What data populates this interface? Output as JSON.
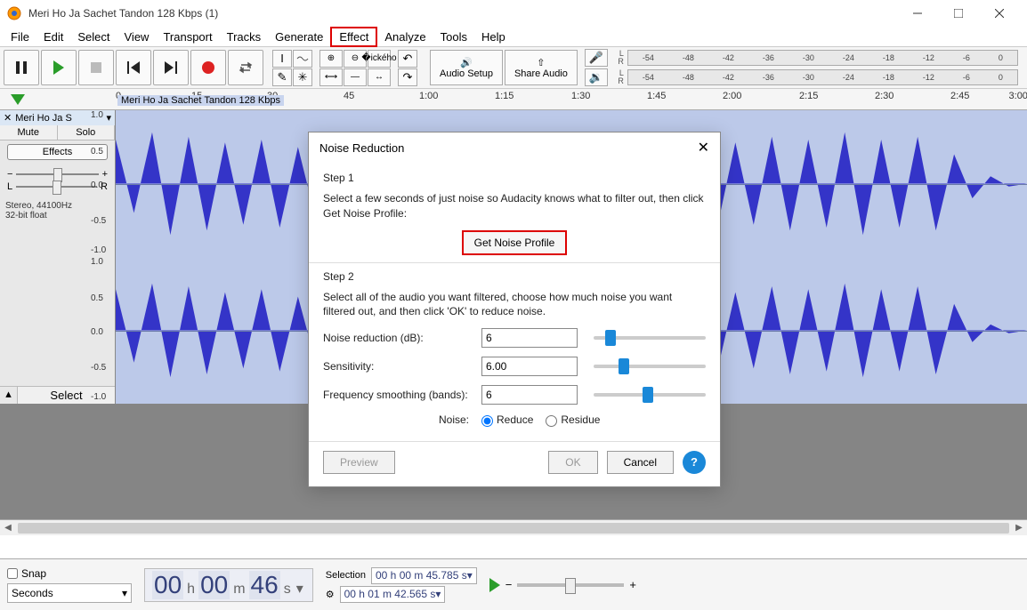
{
  "window": {
    "title": "Meri Ho Ja Sachet Tandon 128 Kbps (1)"
  },
  "menu": [
    "File",
    "Edit",
    "Select",
    "View",
    "Transport",
    "Tracks",
    "Generate",
    "Effect",
    "Analyze",
    "Tools",
    "Help"
  ],
  "menu_highlight": "Effect",
  "toolbar": {
    "audio_setup": "Audio Setup",
    "share_audio": "Share Audio"
  },
  "meter_ticks": [
    "-54",
    "-48",
    "-42",
    "-36",
    "-30",
    "-24",
    "-18",
    "-12",
    "-6",
    "0"
  ],
  "ruler": [
    "0",
    "15",
    "30",
    "45",
    "1:00",
    "1:15",
    "1:30",
    "1:45",
    "2:00",
    "2:15",
    "2:30",
    "2:45",
    "3:00"
  ],
  "track": {
    "name": "Meri Ho Ja S",
    "panel_title": "Meri Ho Ja Sachet Tandon 128 Kbps",
    "mute": "Mute",
    "solo": "Solo",
    "effects": "Effects",
    "meta1": "Stereo, 44100Hz",
    "meta2": "32-bit float",
    "select": "Select",
    "axis": [
      "1.0",
      "0.5",
      "0.0",
      "-0.5",
      "-1.0"
    ]
  },
  "status": {
    "snap": "Snap",
    "snap_unit": "Seconds",
    "time": {
      "h": "00",
      "m": "00",
      "s": "46"
    },
    "sel_label": "Selection",
    "sel_start": "00 h 00 m 45.785 s",
    "sel_end": "00 h 01 m 42.565 s"
  },
  "dialog": {
    "title": "Noise Reduction",
    "step1": "Step 1",
    "desc1": "Select a few seconds of just noise so Audacity knows what to filter out, then click Get Noise Profile:",
    "get_profile": "Get Noise Profile",
    "step2": "Step 2",
    "desc2": "Select all of the audio you want filtered, choose how much noise you want filtered out, and then click 'OK' to reduce noise.",
    "nr_label": "Noise reduction (dB):",
    "nr_val": "6",
    "sens_label": "Sensitivity:",
    "sens_val": "6.00",
    "fs_label": "Frequency smoothing (bands):",
    "fs_val": "6",
    "noise_label": "Noise:",
    "reduce": "Reduce",
    "residue": "Residue",
    "preview": "Preview",
    "ok": "OK",
    "cancel": "Cancel"
  }
}
